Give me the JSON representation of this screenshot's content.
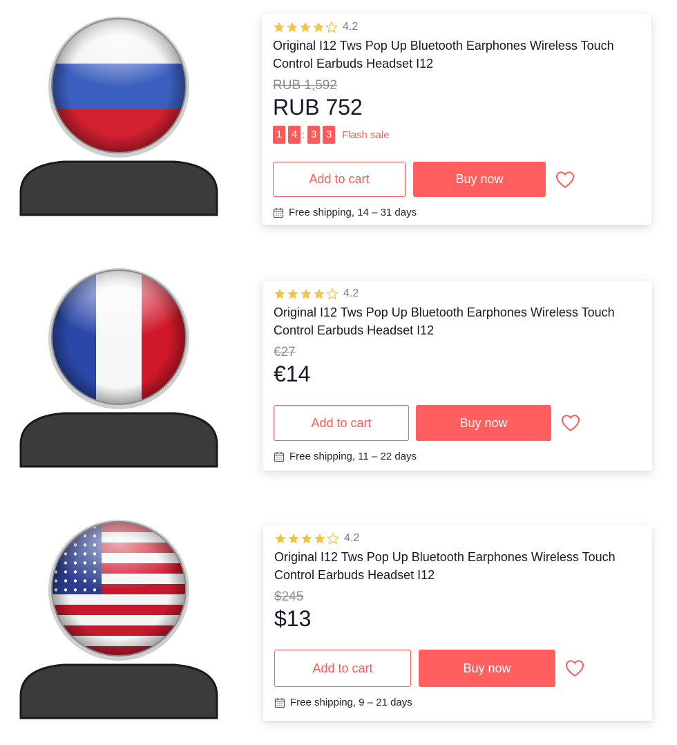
{
  "colors": {
    "accent": "#ff5a5a",
    "star": "#f5c344",
    "avatar_body": "#3b3b3b"
  },
  "cards": [
    {
      "region": "Russia",
      "flag_icon": "russia-flag-icon",
      "rating": "4.2",
      "rating_stars": 4,
      "title": "Original I12 Tws Pop Up Bluetooth Earphones Wireless Touch Control Earbuds Headset I12",
      "old_price": "RUB 1,592",
      "new_price": "RUB 752",
      "flash_sale": {
        "digits": [
          "1",
          "4",
          "3",
          "3"
        ],
        "separator": ":",
        "label": "Flash sale"
      },
      "add_to_cart": "Add to cart",
      "buy_now": "Buy now",
      "shipping": "Free shipping, 14 – 31 days"
    },
    {
      "region": "France",
      "flag_icon": "france-flag-icon",
      "rating": "4.2",
      "rating_stars": 4,
      "title": "Original I12 Tws Pop Up Bluetooth Earphones Wireless Touch Control Earbuds Headset I12",
      "old_price": "€27",
      "new_price": "€14",
      "add_to_cart": "Add to cart",
      "buy_now": "Buy now",
      "shipping": "Free shipping, 11 – 22 days"
    },
    {
      "region": "USA",
      "flag_icon": "usa-flag-icon",
      "rating": "4.2",
      "rating_stars": 4,
      "title": "Original I12 Tws Pop Up Bluetooth Earphones Wireless Touch Control Earbuds Headset I12",
      "old_price": "$245",
      "new_price": "$13",
      "add_to_cart": "Add to cart",
      "buy_now": "Buy now",
      "shipping": "Free shipping, 9 – 21 days"
    }
  ]
}
